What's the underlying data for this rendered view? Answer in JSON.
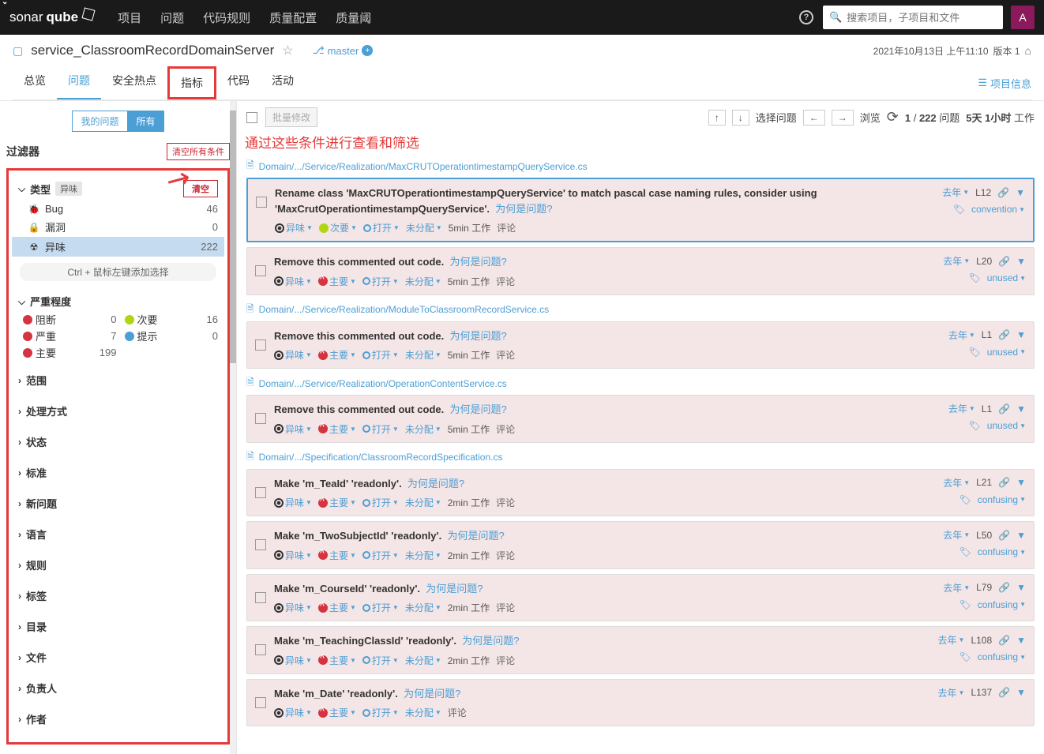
{
  "topnav": {
    "brand1": "sonar",
    "brand2": "qube",
    "items": [
      "项目",
      "问题",
      "代码规则",
      "质量配置",
      "质量阈"
    ],
    "search_placeholder": "搜索项目，子项目和文件",
    "avatar": "A"
  },
  "project": {
    "name": "service_ClassroomRecordDomainServer",
    "branch": "master",
    "date": "2021年10月13日 上午11:10",
    "version_label": "版本 1",
    "tabs": [
      "总览",
      "问题",
      "安全热点",
      "指标",
      "代码",
      "活动"
    ],
    "proj_info": "项目信息"
  },
  "sidebar": {
    "toggle_my": "我的问题",
    "toggle_all": "所有",
    "filter_title": "过滤器",
    "clear_all": "清空所有条件",
    "type": {
      "label": "类型",
      "chip": "异味",
      "clear": "清空",
      "rows": [
        {
          "icon": "🐞",
          "label": "Bug",
          "count": "46"
        },
        {
          "icon": "🔒",
          "label": "漏洞",
          "count": "0"
        },
        {
          "icon": "☢",
          "label": "异味",
          "count": "222",
          "selected": true
        }
      ],
      "hint": "Ctrl + 鼠标左键添加选择"
    },
    "severity": {
      "label": "严重程度",
      "items": [
        {
          "cls": "sd-block",
          "label": "阻断",
          "count": "0"
        },
        {
          "cls": "sd-minor",
          "label": "次要",
          "count": "16"
        },
        {
          "cls": "sd-crit",
          "label": "严重",
          "count": "7"
        },
        {
          "cls": "sd-info",
          "label": "提示",
          "count": "0"
        },
        {
          "cls": "sd-major",
          "label": "主要",
          "count": "199"
        }
      ]
    },
    "facets": [
      "范围",
      "处理方式",
      "状态",
      "标准",
      "新问题",
      "语言",
      "规则",
      "标签",
      "目录",
      "文件",
      "负责人",
      "作者"
    ]
  },
  "toolbar": {
    "bulk": "批量修改",
    "redtext": "通过这些条件进行查看和筛选",
    "select_issue": "选择问题",
    "browse": "浏览",
    "count_cur": "1",
    "count_total": "222",
    "count_suffix": "问题",
    "effort_total": "5天 1小时",
    "work": "工作"
  },
  "labels": {
    "why": "为何是问题?",
    "smell": "异味",
    "major": "主要",
    "minor": "次要",
    "open": "打开",
    "unassigned": "未分配",
    "comment": "评论",
    "work": "工作",
    "lastyear": "去年"
  },
  "files": [
    {
      "path": "Domain/.../Service/Realization/MaxCRUTOperationtimestampQueryService.cs",
      "issues": [
        {
          "title_html": "Rename class 'MaxCRUTOperationtimestampQueryService' to match pascal case naming rules, consider using 'MaxCrutOperationtimestampQueryService'.",
          "sev": "minor",
          "effort": "5min",
          "line": "L12",
          "tag": "convention",
          "selected": true
        },
        {
          "title_html": "Remove this commented out code.",
          "sev": "major",
          "effort": "5min",
          "line": "L20",
          "tag": "unused"
        }
      ]
    },
    {
      "path": "Domain/.../Service/Realization/ModuleToClassroomRecordService.cs",
      "issues": [
        {
          "title_html": "Remove this commented out code.",
          "sev": "major",
          "effort": "5min",
          "line": "L1",
          "tag": "unused"
        }
      ]
    },
    {
      "path": "Domain/.../Service/Realization/OperationContentService.cs",
      "issues": [
        {
          "title_html": "Remove this commented out code.",
          "sev": "major",
          "effort": "5min",
          "line": "L1",
          "tag": "unused"
        }
      ]
    },
    {
      "path": "Domain/.../Specification/ClassroomRecordSpecification.cs",
      "issues": [
        {
          "title_html": "Make 'm_TeaId' 'readonly'.",
          "sev": "major",
          "effort": "2min",
          "line": "L21",
          "tag": "confusing"
        },
        {
          "title_html": "Make 'm_TwoSubjectId' 'readonly'.",
          "sev": "major",
          "effort": "2min",
          "line": "L50",
          "tag": "confusing"
        },
        {
          "title_html": "Make 'm_CourseId' 'readonly'.",
          "sev": "major",
          "effort": "2min",
          "line": "L79",
          "tag": "confusing"
        },
        {
          "title_html": "Make 'm_TeachingClassId' 'readonly'.",
          "sev": "major",
          "effort": "2min",
          "line": "L108",
          "tag": "confusing"
        },
        {
          "title_html": "Make 'm_Date' 'readonly'.",
          "sev": "major",
          "effort": "",
          "line": "L137",
          "tag": ""
        }
      ]
    }
  ]
}
